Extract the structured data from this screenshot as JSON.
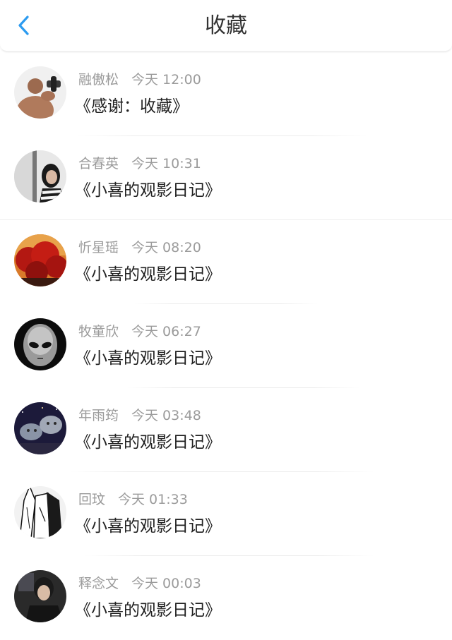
{
  "header": {
    "back_icon": "chevron-left-icon",
    "title": "收藏",
    "accent": "#2c9bf0"
  },
  "items": [
    {
      "name": "融傲松",
      "time": "今天 12:00",
      "content": "《感谢：收藏》"
    },
    {
      "name": "合春英",
      "time": "今天 10:31",
      "content": "《小喜的观影日记》"
    },
    {
      "name": "忻星瑶",
      "time": "今天 08:20",
      "content": "《小喜的观影日记》"
    },
    {
      "name": "牧童欣",
      "time": "今天 06:27",
      "content": "《小喜的观影日记》"
    },
    {
      "name": "年雨筠",
      "time": "今天 03:48",
      "content": "《小喜的观影日记》"
    },
    {
      "name": "回玟",
      "time": "今天 01:33",
      "content": "《小喜的观影日记》"
    },
    {
      "name": "释念文",
      "time": "今天 00:03",
      "content": "《小喜的观影日记》"
    }
  ]
}
